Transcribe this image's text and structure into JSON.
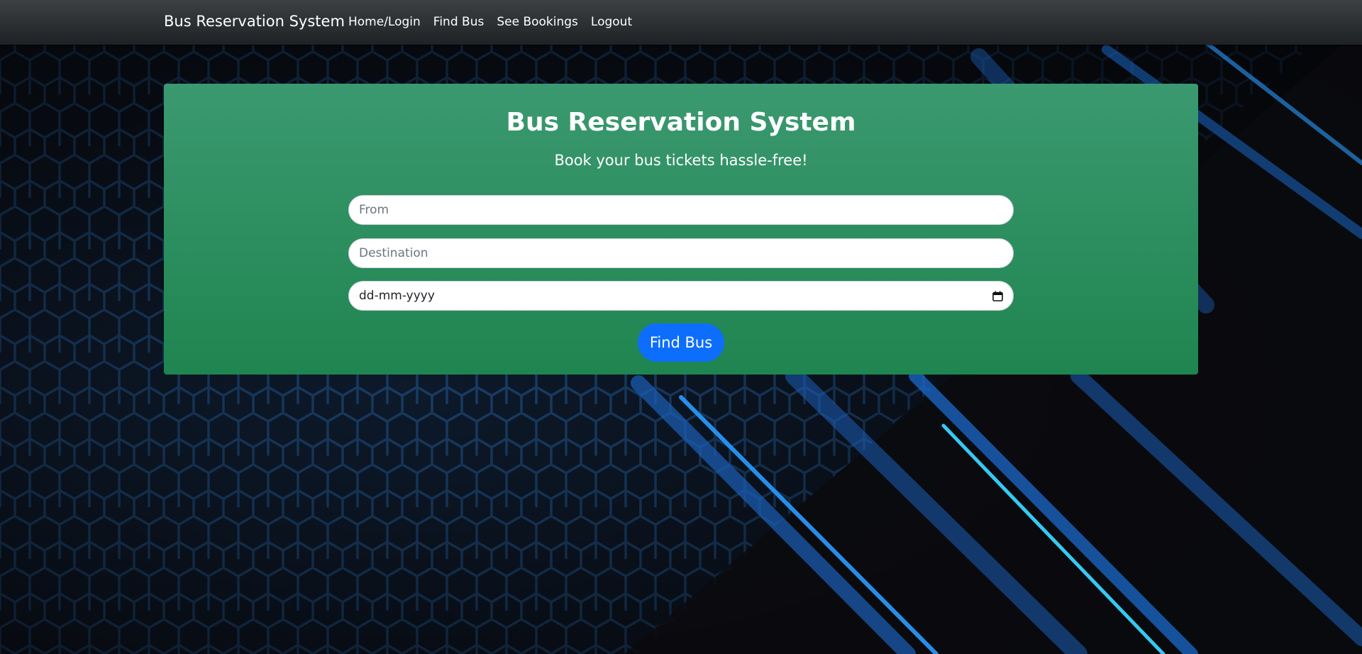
{
  "navbar": {
    "brand": "Bus Reservation System",
    "links": [
      {
        "label": "Home/Login"
      },
      {
        "label": "Find Bus"
      },
      {
        "label": "See Bookings"
      },
      {
        "label": "Logout"
      }
    ]
  },
  "hero": {
    "title": "Bus Reservation System",
    "subtitle": "Book your bus tickets hassle-free!",
    "from_placeholder": "From",
    "destination_placeholder": "Destination",
    "date_placeholder": "dd-mm-yyyy",
    "button_label": "Find Bus"
  },
  "colors": {
    "navbar": "#2b2e31",
    "hero_top": "#3b9970",
    "hero_bottom": "#1f8550",
    "button": "#0d6efd"
  },
  "icons": {
    "date_field": "calendar-icon"
  }
}
